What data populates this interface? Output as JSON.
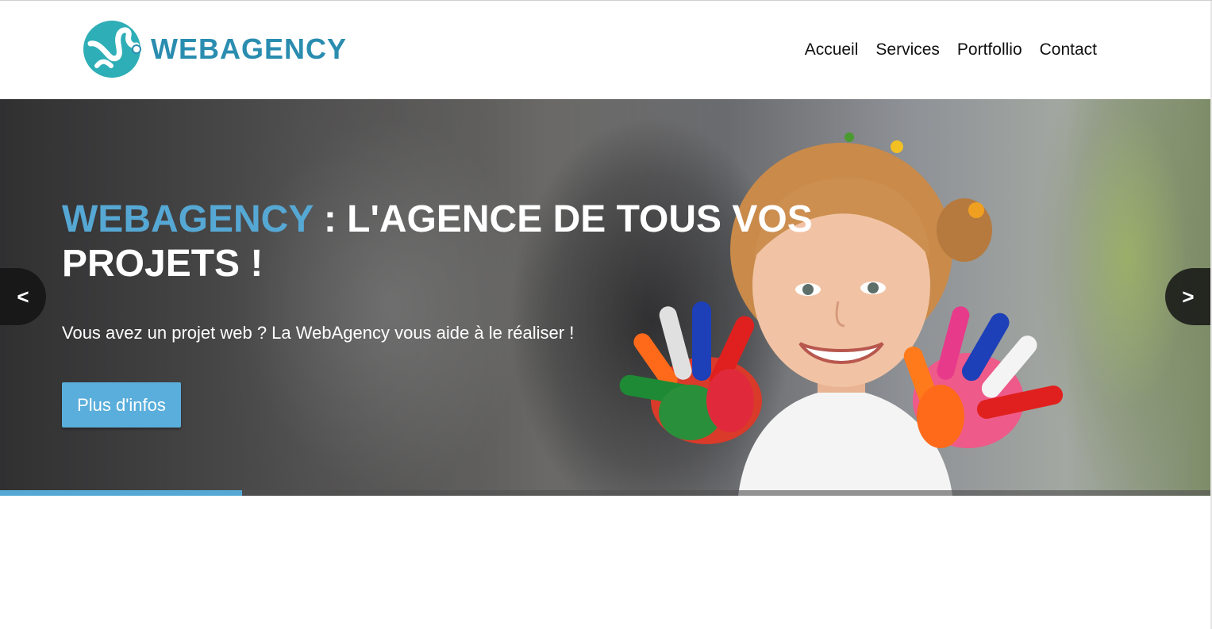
{
  "brand": {
    "logo_text": "WEBAGENCY",
    "logo_color": "#2a8db0",
    "logo_icon": "webagency-logo-icon"
  },
  "nav": {
    "items": [
      {
        "label": "Accueil"
      },
      {
        "label": "Services"
      },
      {
        "label": "Portfollio"
      },
      {
        "label": "Contact"
      }
    ]
  },
  "hero": {
    "title_brand": "WEBAGENCY",
    "title_rest": " : L'AGENCE DE TOUS VOS PROJETS !",
    "subtitle": "Vous avez un projet web ? La WebAgency vous aide à le réaliser !",
    "button_label": "Plus d'infos",
    "prev_label": "<",
    "next_label": ">",
    "progress": 0.2,
    "accent_color": "#56a8d4"
  }
}
